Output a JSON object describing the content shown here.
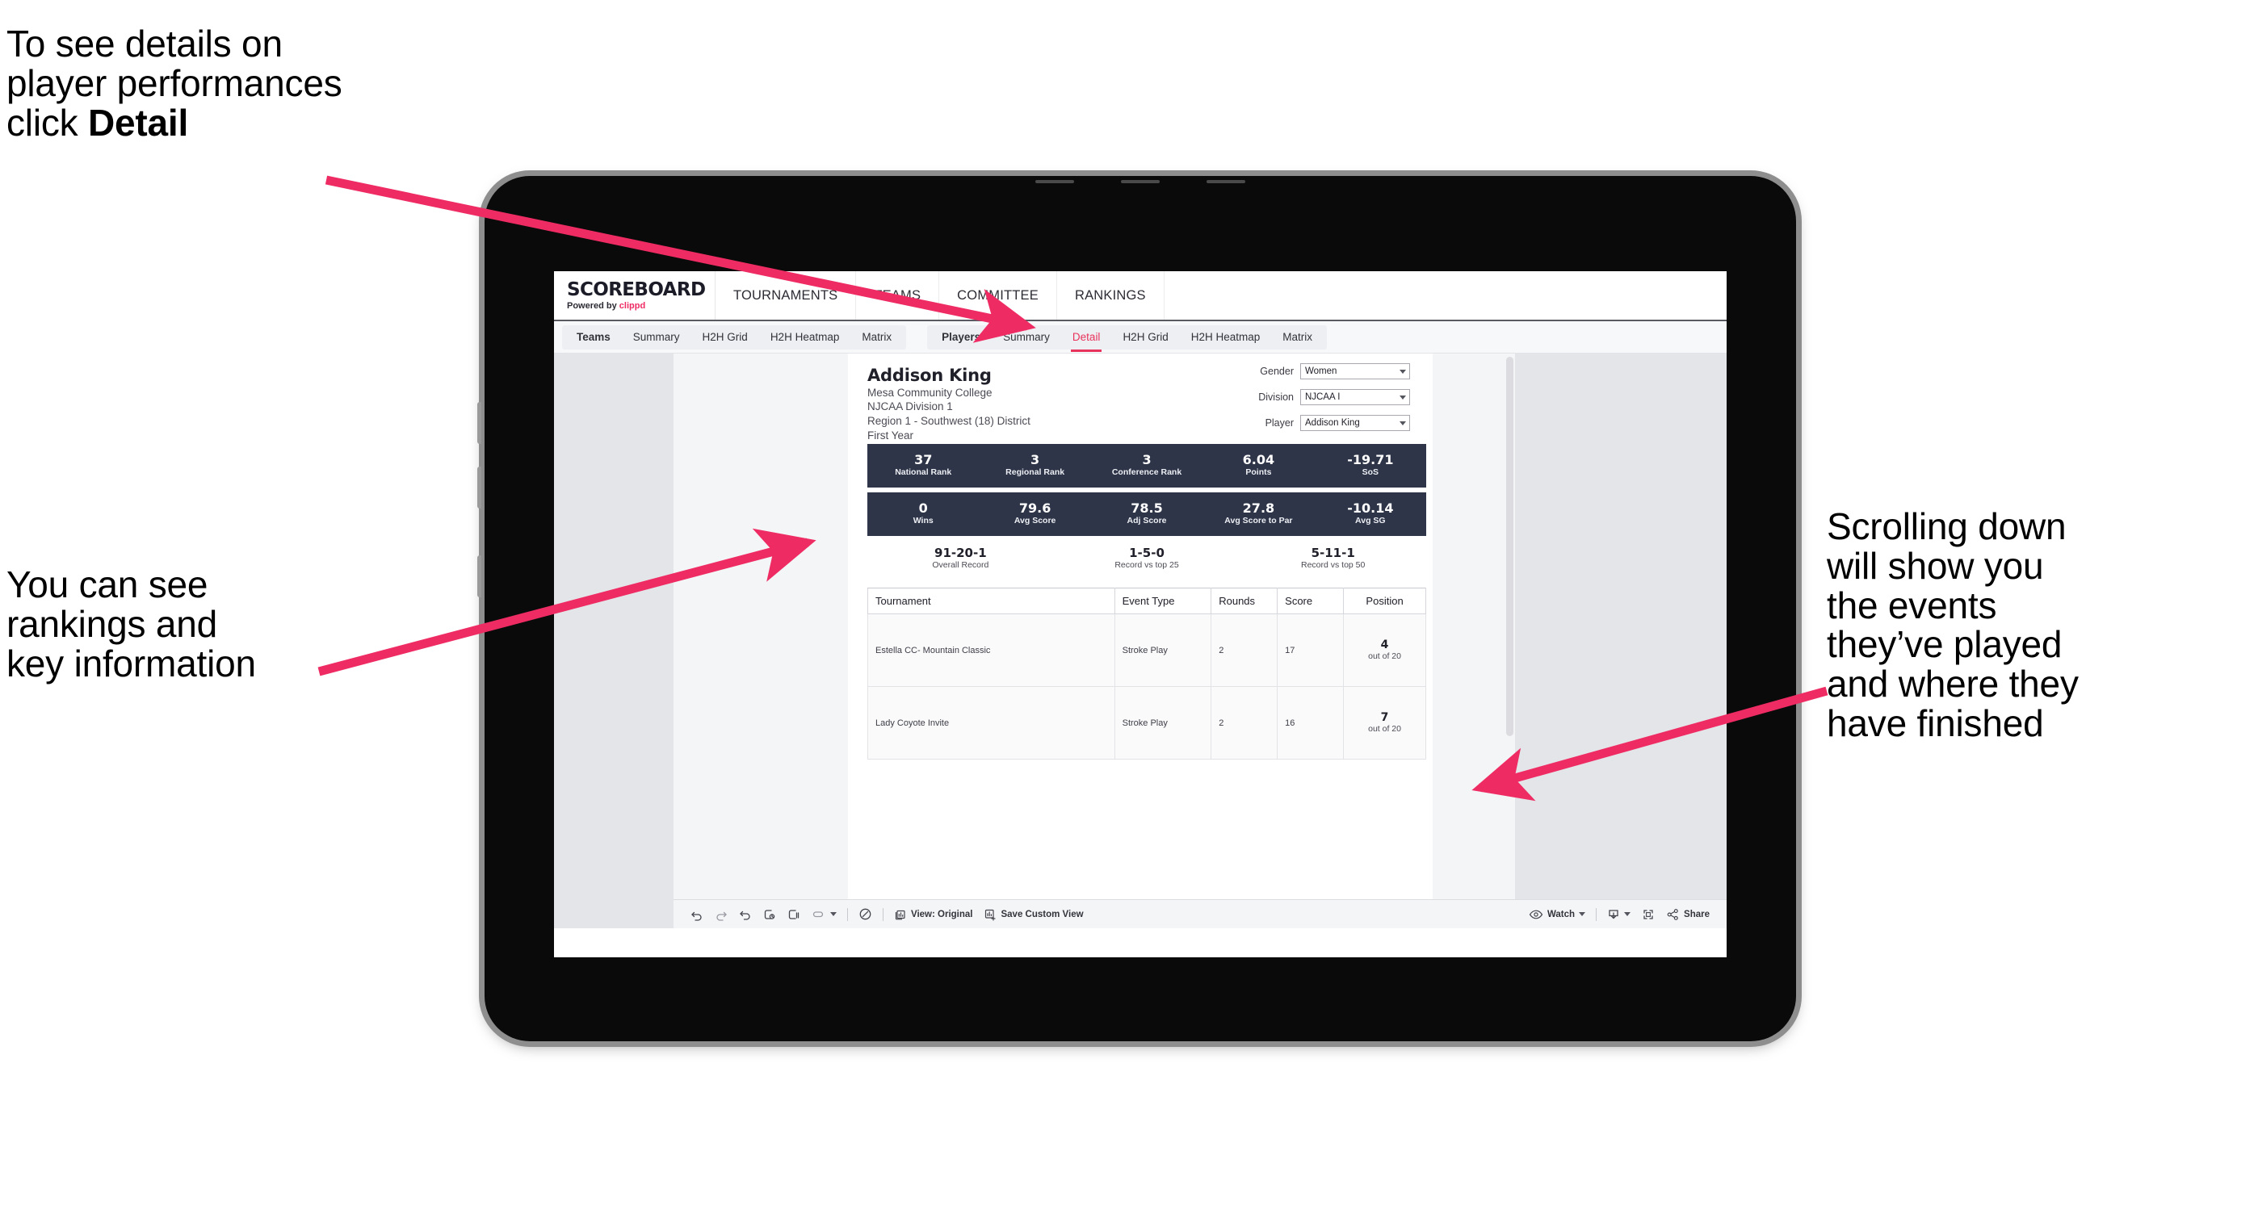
{
  "annotations": {
    "top_left": {
      "lines": [
        "To see details on",
        "player performances",
        "click "
      ],
      "emphasis": "Detail"
    },
    "left": {
      "lines": [
        "You can see",
        "rankings and",
        "key information"
      ]
    },
    "right": {
      "lines": [
        "Scrolling down",
        "will show you",
        "the events",
        "they’ve played",
        "and where they",
        "have finished"
      ]
    },
    "arrow_color": "#ef2b63"
  },
  "app": {
    "brand": {
      "title": "SCOREBOARD",
      "powered_prefix": "Powered by ",
      "powered_name": "clippd",
      "accent": "#ef2b63"
    },
    "top_nav": [
      "TOURNAMENTS",
      "TEAMS",
      "COMMITTEE",
      "RANKINGS"
    ],
    "subnav": {
      "teams_group": [
        "Teams",
        "Summary",
        "H2H Grid",
        "H2H Heatmap",
        "Matrix"
      ],
      "players_group": [
        "Players",
        "Summary",
        "Detail",
        "H2H Grid",
        "H2H Heatmap",
        "Matrix"
      ],
      "active_tab": "Detail",
      "active_color": "#e8335c"
    }
  },
  "player": {
    "name": "Addison King",
    "school": "Mesa Community College",
    "division": "NJCAA Division 1",
    "region": "Region 1 - Southwest (18) District",
    "year": "First Year"
  },
  "filters": [
    {
      "label": "Gender",
      "value": "Women"
    },
    {
      "label": "Division",
      "value": "NJCAA I"
    },
    {
      "label": "Player",
      "value": "Addison King"
    }
  ],
  "stats_row_1": [
    {
      "value": "37",
      "label": "National Rank"
    },
    {
      "value": "3",
      "label": "Regional Rank"
    },
    {
      "value": "3",
      "label": "Conference Rank"
    },
    {
      "value": "6.04",
      "label": "Points"
    },
    {
      "value": "-19.71",
      "label": "SoS"
    }
  ],
  "stats_row_2": [
    {
      "value": "0",
      "label": "Wins"
    },
    {
      "value": "79.6",
      "label": "Avg Score"
    },
    {
      "value": "78.5",
      "label": "Adj Score"
    },
    {
      "value": "27.8",
      "label": "Avg Score to Par"
    },
    {
      "value": "-10.14",
      "label": "Avg SG"
    }
  ],
  "records": [
    {
      "value": "91-20-1",
      "label": "Overall Record"
    },
    {
      "value": "1-5-0",
      "label": "Record vs top 25"
    },
    {
      "value": "5-11-1",
      "label": "Record vs top 50"
    }
  ],
  "events_table": {
    "headers": [
      "Tournament",
      "Event Type",
      "Rounds",
      "Score",
      "Position"
    ],
    "rows": [
      {
        "tournament": "Estella CC- Mountain Classic",
        "event_type": "Stroke Play",
        "rounds": "2",
        "score": "17",
        "position_rank": "4",
        "position_of": "out of 20"
      },
      {
        "tournament": "Lady Coyote Invite",
        "event_type": "Stroke Play",
        "rounds": "2",
        "score": "16",
        "position_rank": "7",
        "position_of": "out of 20"
      }
    ]
  },
  "toolbar": {
    "view_label": "View: Original",
    "save_custom_view": "Save Custom View",
    "watch": "Watch",
    "share": "Share"
  },
  "theme": {
    "stat_bar_bg": "#2e3548",
    "viz_bg": "#e4e5e9",
    "sheet_bg": "#f4f5f7"
  }
}
